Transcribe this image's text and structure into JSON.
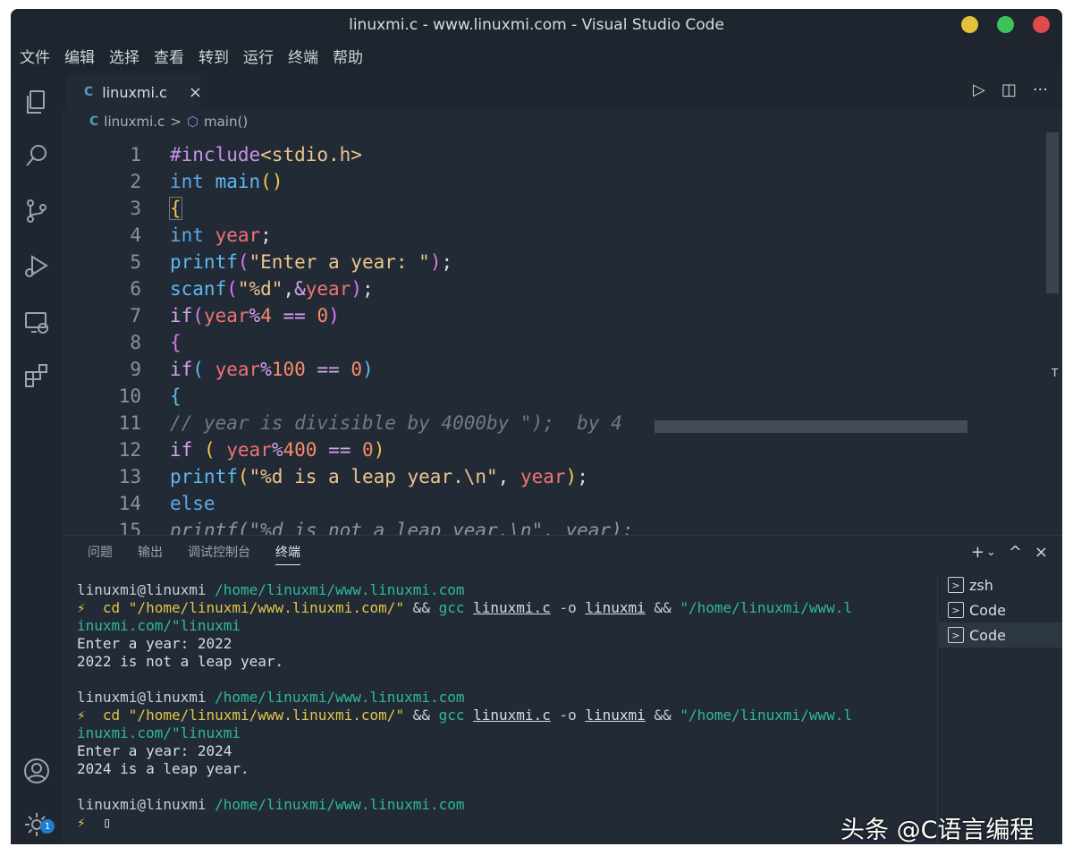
{
  "window": {
    "title": "linuxmi.c - www.linuxmi.com - Visual Studio Code",
    "buttons": {
      "minimize": "#e5c13a",
      "maximize": "#3cc45a",
      "close": "#e24a4a"
    }
  },
  "menu": [
    "文件",
    "编辑",
    "选择",
    "查看",
    "转到",
    "运行",
    "终端",
    "帮助"
  ],
  "activity_icons": [
    "explorer-icon",
    "search-icon",
    "source-control-icon",
    "run-debug-icon",
    "remote-explorer-icon",
    "extensions-icon",
    "account-icon",
    "settings-gear-icon"
  ],
  "activity_badge": "1",
  "tab": {
    "icon": "C",
    "label": "linuxmi.c",
    "close": "×"
  },
  "editor_actions": [
    "▷",
    "◫",
    "···"
  ],
  "breadcrumb": {
    "file_icon": "C",
    "file": "linuxmi.c",
    "sep": ">",
    "symbol_icon": "⬡",
    "symbol": "main()"
  },
  "code_lines": [
    {
      "n": "1",
      "text": "#include<stdio.h>"
    },
    {
      "n": "2",
      "text": "int main()"
    },
    {
      "n": "3",
      "text": "{"
    },
    {
      "n": "4",
      "text": "int year;"
    },
    {
      "n": "5",
      "text": "printf(\"Enter a year: \");"
    },
    {
      "n": "6",
      "text": "scanf(\"%d\",&year);"
    },
    {
      "n": "7",
      "text": "if(year%4 == 0)"
    },
    {
      "n": "8",
      "text": "{"
    },
    {
      "n": "9",
      "text": "if( year%100 == 0)"
    },
    {
      "n": "10",
      "text": "{"
    },
    {
      "n": "11",
      "text": "// year is divisible by 4000by \");  by 4"
    },
    {
      "n": "12",
      "text": "if ( year%400 == 0)"
    },
    {
      "n": "13",
      "text": "printf(\"%d is a leap year.\\n\", year);"
    },
    {
      "n": "14",
      "text": "else"
    },
    {
      "n": "15",
      "text": "printf(\"%d is not a leap year.\\n\", year);"
    }
  ],
  "panel": {
    "tabs": [
      "问题",
      "输出",
      "调试控制台",
      "终端"
    ],
    "active_tab": "终端",
    "actions": [
      "+",
      "⌄",
      "^",
      "×"
    ]
  },
  "terminal": {
    "prompt_user": "linuxmi@linuxmi",
    "prompt_path": "/home/linuxmi/www.linuxmi.com",
    "cmd_prefix": "⚡  cd ",
    "cmd_dir": "\"/home/linuxmi/www.linuxmi.com/\"",
    "cmd_and": " && ",
    "cmd_gcc": "gcc",
    "cmd_src": "linuxmi.c",
    "cmd_o": " -o ",
    "cmd_out": "linuxmi",
    "cmd_run_a": "\"/home/linuxmi/www.l",
    "cmd_run_b": "inuxmi.com/\"linuxmi",
    "session1": {
      "input": "Enter a year: 2022",
      "output": "2022 is not a leap year."
    },
    "session2": {
      "input": "Enter a year: 2024",
      "output": "2024 is a leap year."
    },
    "final_prompt": "⚡ ",
    "cursor": "▯"
  },
  "terminal_list": [
    {
      "icon": ">",
      "label": "zsh"
    },
    {
      "icon": ">",
      "label": "Code"
    },
    {
      "icon": ">",
      "label": "Code"
    }
  ],
  "watermark": "头条 @C语言编程"
}
